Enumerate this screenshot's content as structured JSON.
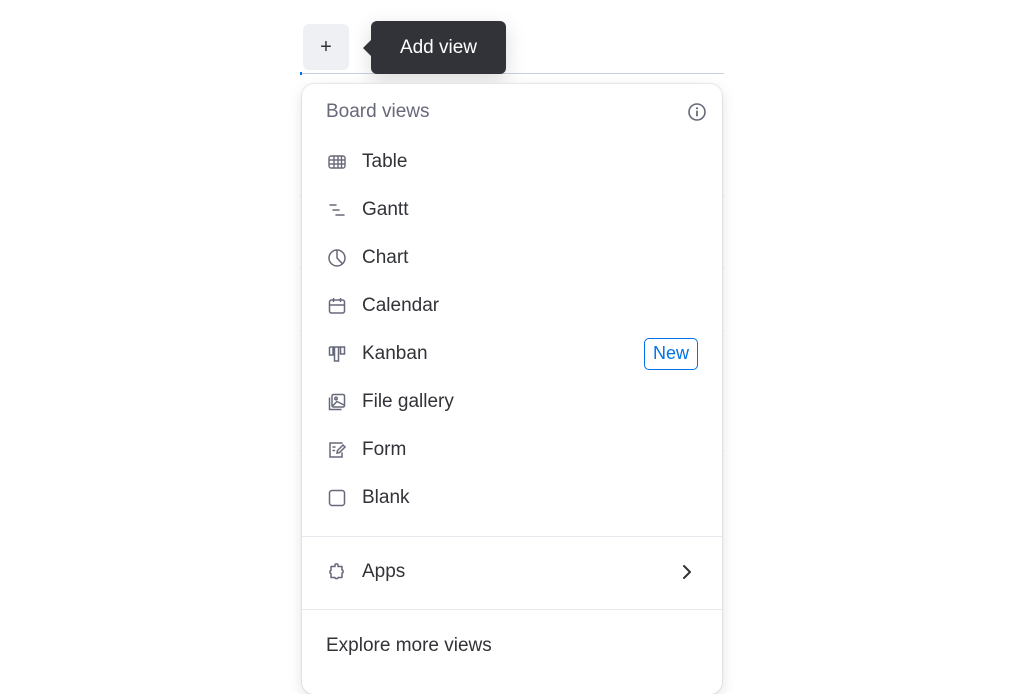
{
  "toolbar": {
    "add_button_label": "+",
    "tooltip": "Add view"
  },
  "menu": {
    "header": "Board views",
    "header_icon": "info-icon",
    "items": [
      {
        "label": "Table",
        "icon": "table-icon"
      },
      {
        "label": "Gantt",
        "icon": "gantt-icon"
      },
      {
        "label": "Chart",
        "icon": "chart-icon"
      },
      {
        "label": "Calendar",
        "icon": "calendar-icon"
      },
      {
        "label": "Kanban",
        "icon": "kanban-icon",
        "badge": "New"
      },
      {
        "label": "File gallery",
        "icon": "file-gallery-icon"
      },
      {
        "label": "Form",
        "icon": "form-icon"
      },
      {
        "label": "Blank",
        "icon": "blank-icon"
      }
    ],
    "apps": {
      "label": "Apps",
      "icon": "puzzle-icon",
      "trailing_icon": "chevron-right-icon"
    },
    "explore": "Explore more views"
  },
  "colors": {
    "accent": "#0073ea",
    "text_primary": "#323338",
    "text_secondary": "#676879",
    "tooltip_bg": "#323338"
  }
}
